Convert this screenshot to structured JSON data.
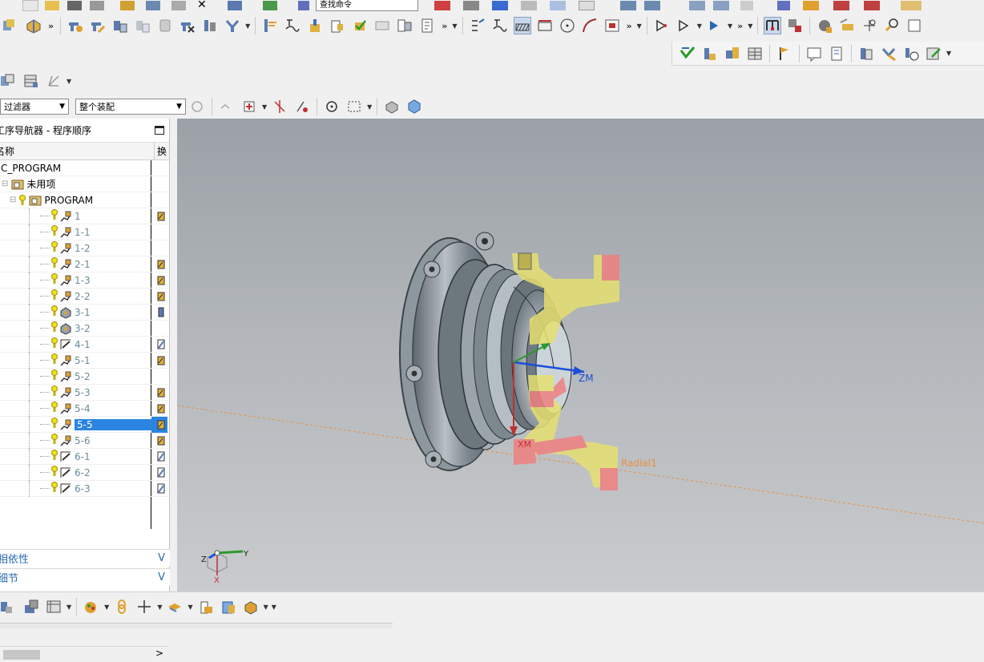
{
  "toolbar": {
    "row1_field": "查找命令",
    "filter_select": "过滤器",
    "assembly_select": "整个装配",
    "more": "»"
  },
  "navigator": {
    "title": "工序导航器 - 程序顺序",
    "col_name": "名称",
    "col_change": "换",
    "root": "NC_PROGRAM",
    "unused": "未用项",
    "program": "PROGRAM",
    "operations": [
      {
        "name": "1",
        "op": "mill",
        "tool": "gold",
        "dim": true
      },
      {
        "name": "1-1",
        "op": "mill",
        "tool": "",
        "dim": true
      },
      {
        "name": "1-2",
        "op": "mill",
        "tool": "",
        "dim": true
      },
      {
        "name": "2-1",
        "op": "mill",
        "tool": "gold",
        "dim": true
      },
      {
        "name": "1-3",
        "op": "mill",
        "tool": "gold",
        "dim": true
      },
      {
        "name": "2-2",
        "op": "mill",
        "tool": "gold",
        "dim": true
      },
      {
        "name": "3-1",
        "op": "cube",
        "tool": "blue",
        "dim": true
      },
      {
        "name": "3-2",
        "op": "cube",
        "tool": "",
        "dim": true
      },
      {
        "name": "4-1",
        "op": "path",
        "tool": "drill",
        "dim": true
      },
      {
        "name": "5-1",
        "op": "mill",
        "tool": "gold",
        "dim": true
      },
      {
        "name": "5-2",
        "op": "mill",
        "tool": "",
        "dim": true
      },
      {
        "name": "5-3",
        "op": "mill",
        "tool": "gold",
        "dim": true
      },
      {
        "name": "5-4",
        "op": "mill",
        "tool": "gold",
        "dim": true
      },
      {
        "name": "5-5",
        "op": "mill",
        "tool": "gold",
        "dim": false,
        "selected": true
      },
      {
        "name": "5-6",
        "op": "mill",
        "tool": "gold",
        "dim": true
      },
      {
        "name": "6-1",
        "op": "path",
        "tool": "drill",
        "dim": true
      },
      {
        "name": "6-2",
        "op": "path",
        "tool": "drill",
        "dim": true
      },
      {
        "name": "6-3",
        "op": "path",
        "tool": "drill",
        "dim": true
      }
    ],
    "panel_dependencies": "相依性",
    "panel_details": "细节",
    "collapse_glyph": "V",
    "scroll_right": ">"
  },
  "viewport": {
    "label_zm": "ZM",
    "label_xm": "XM",
    "label_radial": "Radial1",
    "triad_y": "Y",
    "triad_z": "Z",
    "triad_x": "X"
  },
  "colors": {
    "selection": "#2a84e0",
    "section_yellow": "#e6e070",
    "section_red": "#f08080",
    "part_gray": "#8a949c",
    "axis_blue": "#1a4fd8",
    "radial_orange": "#e89040"
  }
}
